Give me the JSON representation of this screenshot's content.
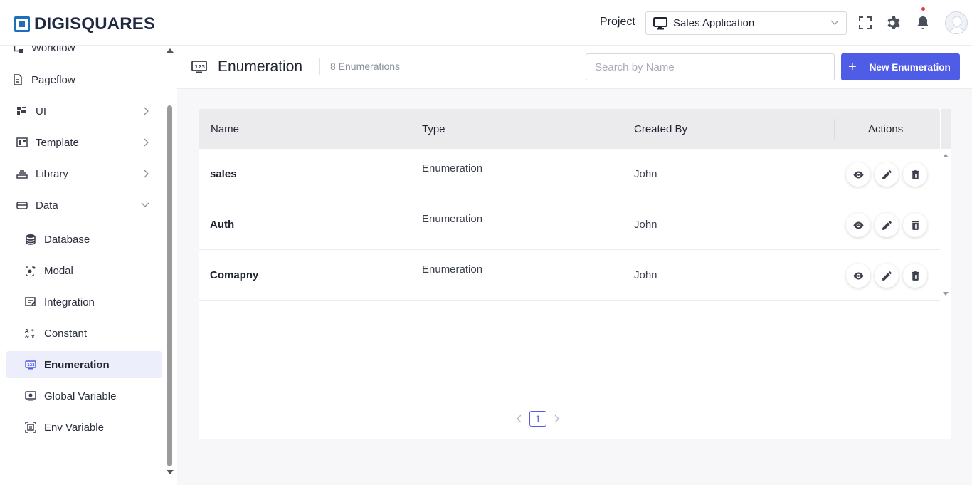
{
  "brand": {
    "name": "DIGISQUARES",
    "color": "#1e6fb8"
  },
  "header": {
    "project_label": "Project",
    "project_value": "Sales Application",
    "icons": [
      "fullscreen-icon",
      "gear-icon",
      "bell-icon",
      "avatar"
    ]
  },
  "sidebar": {
    "items": [
      {
        "label": "Workflow",
        "icon": "workflow-icon"
      },
      {
        "label": "Pageflow",
        "icon": "pageflow-icon"
      },
      {
        "label": "UI",
        "icon": "ui-icon",
        "expandable": true
      },
      {
        "label": "Template",
        "icon": "template-icon",
        "expandable": true
      },
      {
        "label": "Library",
        "icon": "library-icon",
        "expandable": true
      },
      {
        "label": "Data",
        "icon": "data-icon",
        "expanded": true
      },
      {
        "label": "Database",
        "icon": "database-icon"
      },
      {
        "label": "Modal",
        "icon": "modal-icon"
      },
      {
        "label": "Integration",
        "icon": "integration-icon"
      },
      {
        "label": "Constant",
        "icon": "constant-icon"
      },
      {
        "label": "Enumeration",
        "icon": "enumeration-icon",
        "active": true
      },
      {
        "label": "Global Variable",
        "icon": "global-variable-icon"
      },
      {
        "label": "Env Variable",
        "icon": "env-variable-icon"
      }
    ]
  },
  "page": {
    "title": "Enumeration",
    "count": "8 Enumerations",
    "search_placeholder": "Search by Name",
    "new_button": "New Enumeration",
    "accent": "#4f5ce6"
  },
  "table": {
    "columns": [
      "Name",
      "Type",
      "Created By",
      "Actions"
    ],
    "rows": [
      {
        "name": "sales",
        "type": "Enumeration",
        "created_by": "John"
      },
      {
        "name": "Auth",
        "type": "Enumeration",
        "created_by": "John"
      },
      {
        "name": "Comapny",
        "type": "Enumeration",
        "created_by": "John"
      }
    ]
  },
  "pagination": {
    "current": "1"
  }
}
